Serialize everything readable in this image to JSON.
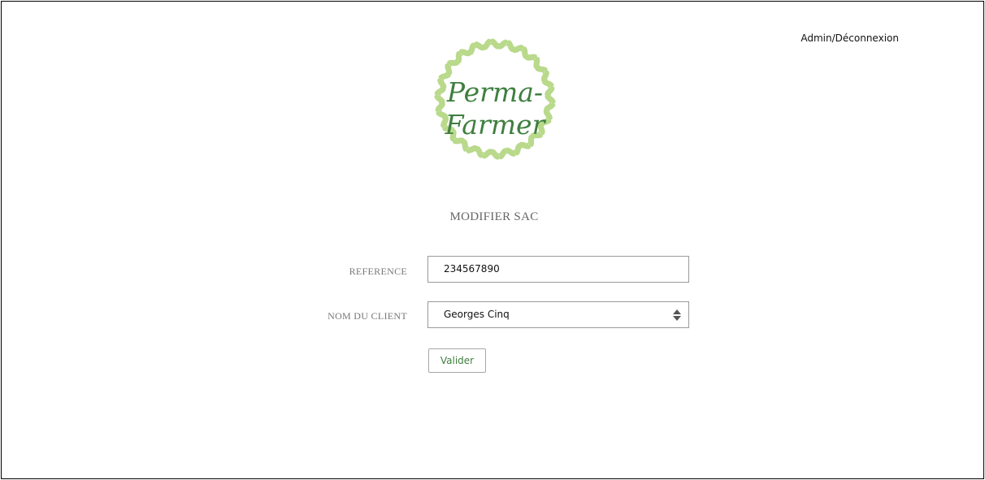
{
  "header": {
    "admin_link": "Admin/Déconnexion"
  },
  "brand": {
    "logo_text": "Perma-Farmer",
    "logo_color": "#3f7f3f",
    "wreath_color": "#b9d98b"
  },
  "form": {
    "title": "MODIFIER SAC",
    "reference": {
      "label": "REFERENCE",
      "value": "234567890"
    },
    "client": {
      "label": "NOM DU CLIENT",
      "selected": "Georges Cinq"
    },
    "submit_label": "Valider"
  }
}
